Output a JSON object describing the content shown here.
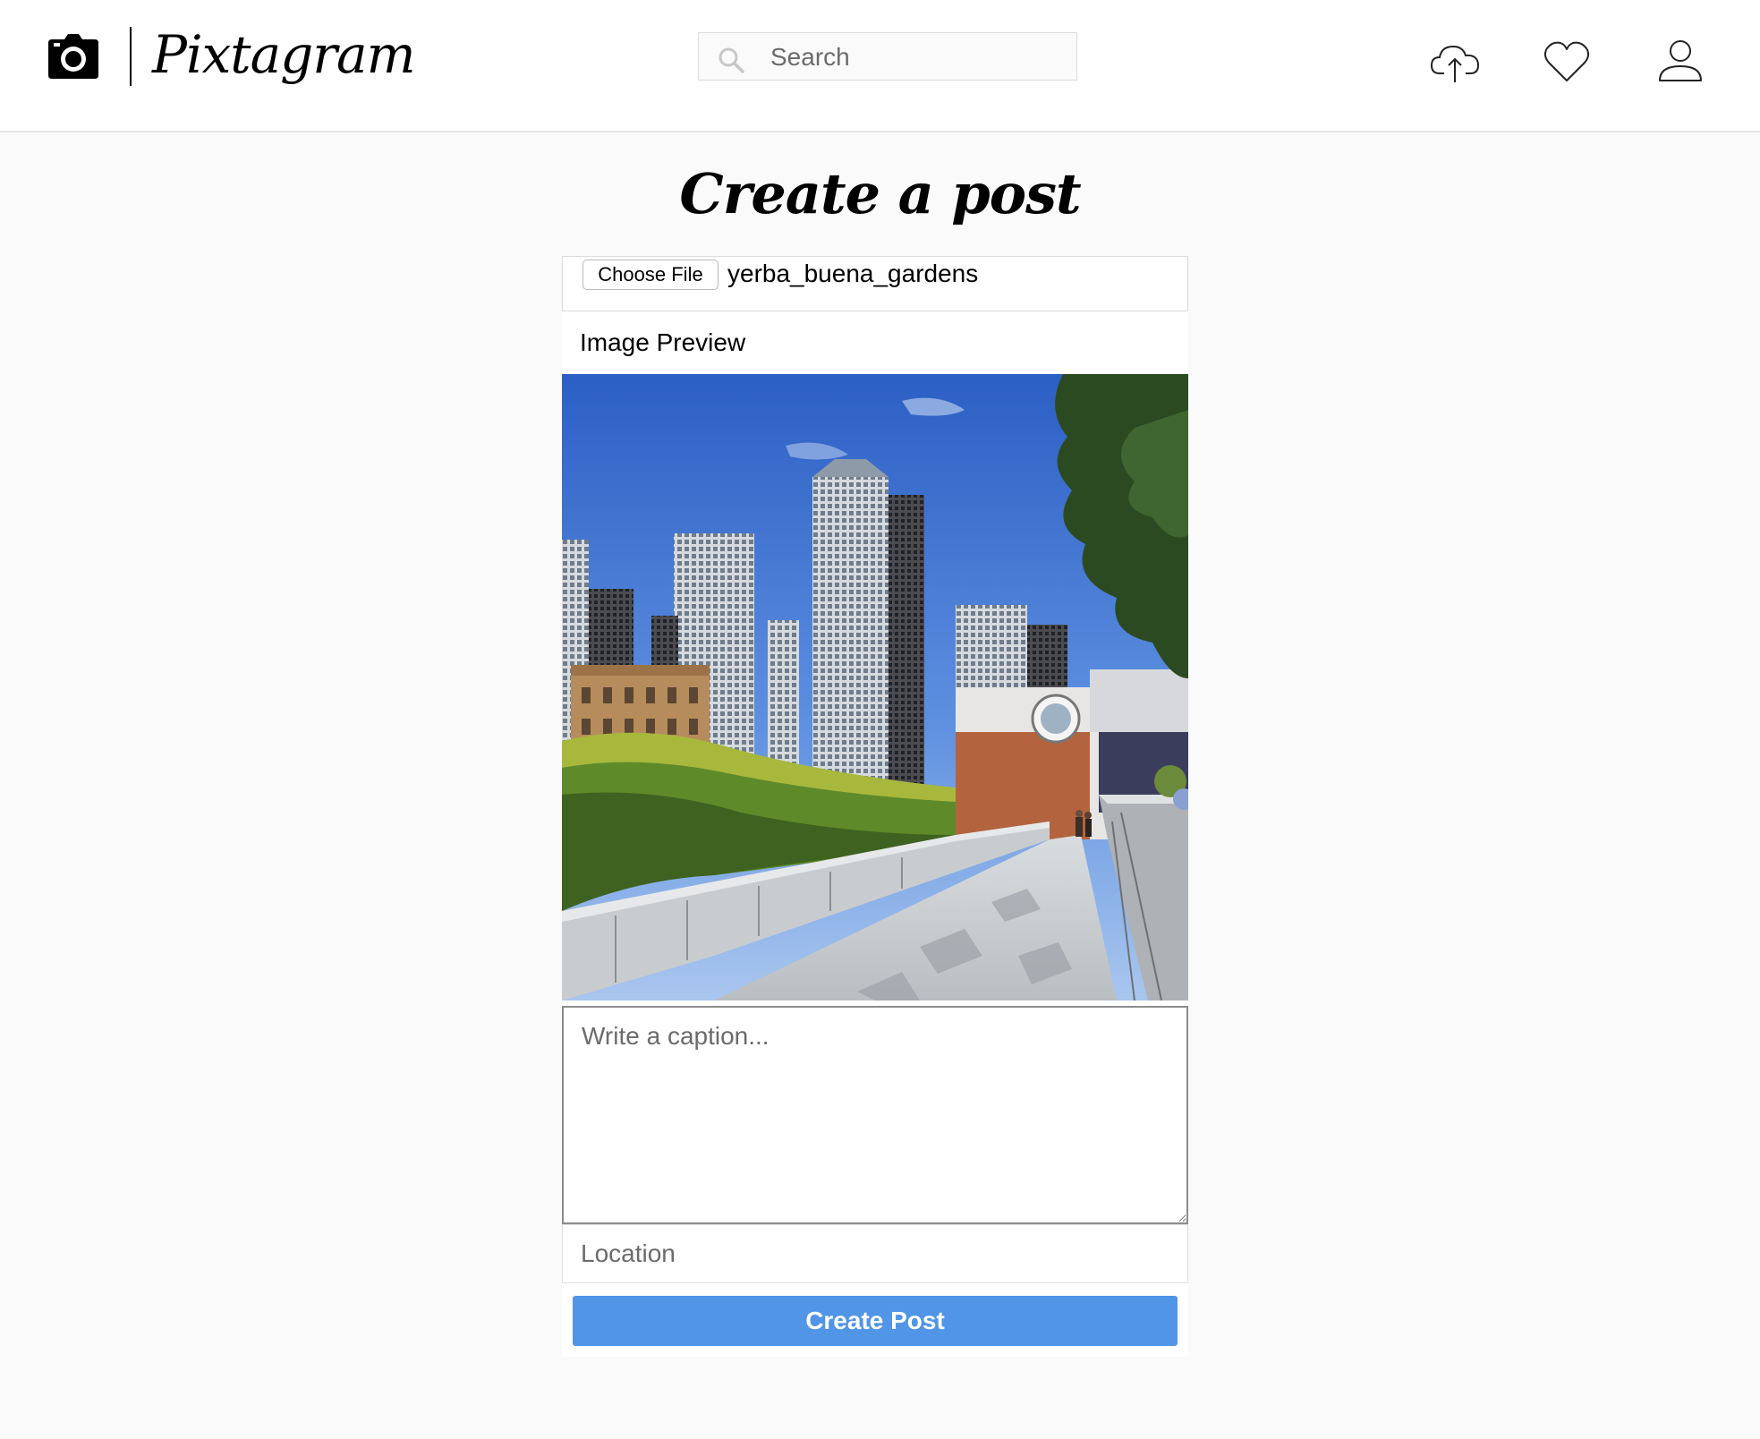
{
  "app": {
    "name": "Pixtagram"
  },
  "header": {
    "logo_icon": "camera-icon",
    "search": {
      "placeholder": "Search",
      "icon": "search-icon"
    },
    "nav_icons": [
      "cloud-upload-icon",
      "heart-icon",
      "user-icon"
    ]
  },
  "main": {
    "title": "Create a post",
    "file_input": {
      "button_label": "Choose File",
      "file_name": "yerba_buena_gardens"
    },
    "preview": {
      "label": "Image Preview"
    },
    "caption": {
      "placeholder": "Write a caption..."
    },
    "location": {
      "placeholder": "Location"
    },
    "submit_label": "Create Post"
  },
  "colors": {
    "accent": "#5095e6",
    "page_background": "#fafafa",
    "header_background": "#ffffff",
    "border": "#dbdbdb"
  }
}
